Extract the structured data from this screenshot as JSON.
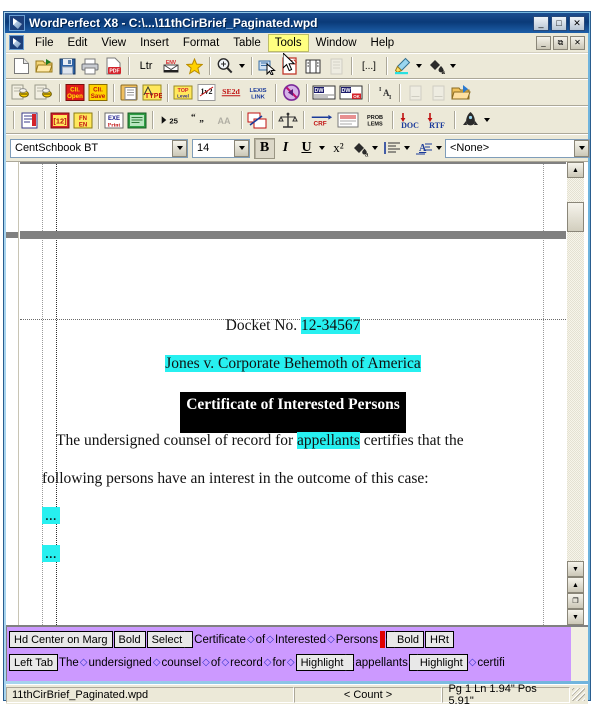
{
  "window": {
    "title": "WordPerfect X8 - C:\\...\\11thCirBrief_Paginated.wpd",
    "app_icon": "pen-nib-icon",
    "buttons": {
      "minimize": "_",
      "maximize": "□",
      "close": "✕"
    },
    "doc_buttons": {
      "minimize": "_",
      "restore": "⧉",
      "close": "✕"
    },
    "titlebar_color": "#0a3a78"
  },
  "menu": {
    "items": [
      {
        "label": "File",
        "accel": "F",
        "active": false
      },
      {
        "label": "Edit",
        "accel": "E",
        "active": false
      },
      {
        "label": "View",
        "accel": "V",
        "active": false
      },
      {
        "label": "Insert",
        "accel": "I",
        "active": false
      },
      {
        "label": "Format",
        "accel": "o",
        "active": false
      },
      {
        "label": "Table",
        "accel": "a",
        "active": false
      },
      {
        "label": "Tools",
        "accel": "T",
        "active": true
      },
      {
        "label": "Window",
        "accel": "W",
        "active": false
      },
      {
        "label": "Help",
        "accel": "H",
        "active": false
      }
    ],
    "highlight_color": "#ffff80"
  },
  "toolbar1": {
    "buttons": [
      {
        "name": "new-document-icon",
        "glyph": "🗋"
      },
      {
        "name": "open-document-icon",
        "glyph": "📂"
      },
      {
        "name": "save-document-icon",
        "glyph": "💾"
      },
      {
        "name": "print-icon",
        "glyph": "🖨"
      },
      {
        "name": "publish-pdf-icon",
        "glyph": "PDF"
      },
      {
        "name": "letter-template-icon",
        "glyph": "Ltr"
      },
      {
        "name": "envelope-icon",
        "glyph": "ENV"
      },
      {
        "name": "favorites-star-icon",
        "glyph": "★"
      },
      {
        "name": "zoom-icon",
        "glyph": "Q"
      },
      {
        "name": "select-tool-icon",
        "glyph": "⬚"
      },
      {
        "name": "new-page-icon",
        "glyph": "🗏"
      },
      {
        "name": "reveal-codes-icon",
        "glyph": "▥"
      },
      {
        "name": "columns-icon",
        "glyph": "▤"
      },
      {
        "name": "insert-field-icon",
        "glyph": "[...]"
      },
      {
        "name": "highlighter-icon",
        "glyph": "🖊"
      },
      {
        "name": "font-color-icon",
        "glyph": "🎨"
      }
    ]
  },
  "toolbar2": {
    "buttons": [
      {
        "name": "bee-insert-icon",
        "glyph": "🐝"
      },
      {
        "name": "bee-extract-icon",
        "glyph": "🐝"
      },
      {
        "name": "clipboard-open-icon",
        "glyph": "Cli.Open"
      },
      {
        "name": "clipboard-save-icon",
        "glyph": "Cli.Save"
      },
      {
        "name": "paste-list-icon",
        "glyph": "📋"
      },
      {
        "name": "type-icon",
        "glyph": "TYPE"
      },
      {
        "name": "top-level-icon",
        "glyph": "TOP"
      },
      {
        "name": "one-v-two-icon",
        "glyph": "1v2"
      },
      {
        "name": "se2d-icon",
        "glyph": "SE2d"
      },
      {
        "name": "lexis-link-icon",
        "glyph": "LEXIS LINK"
      },
      {
        "name": "no-link-icon",
        "glyph": "🚫"
      },
      {
        "name": "word-export-icon",
        "glyph": "DW"
      },
      {
        "name": "word-export-ok-icon",
        "glyph": "DW OK"
      },
      {
        "name": "text-format-icon",
        "glyph": "IA"
      },
      {
        "name": "page-left-icon",
        "glyph": "🗐"
      },
      {
        "name": "page-right-icon",
        "glyph": "🗐"
      },
      {
        "name": "open-folder-icon",
        "glyph": "📂"
      }
    ]
  },
  "toolbar3": {
    "buttons": [
      {
        "name": "table-of-authorities-icon",
        "glyph": "📕"
      },
      {
        "name": "numbering-icon",
        "glyph": "[12]"
      },
      {
        "name": "footnote-endnote-icon",
        "glyph": "FN↔EN"
      },
      {
        "name": "exe-print-icon",
        "glyph": "EXE Print"
      },
      {
        "name": "green-doc-icon",
        "glyph": "▤"
      },
      {
        "name": "jump-25-icon",
        "glyph": "▸25"
      },
      {
        "name": "quote-icon",
        "glyph": "“”"
      },
      {
        "name": "compare-icon",
        "glyph": "AA"
      },
      {
        "name": "swap-icon",
        "glyph": "⇄"
      },
      {
        "name": "scales-of-justice-icon",
        "glyph": "⚖"
      },
      {
        "name": "crf-icon",
        "glyph": "CRF"
      },
      {
        "name": "draft-icon",
        "glyph": "▤"
      },
      {
        "name": "problems-icon",
        "glyph": "PROB LEMS"
      },
      {
        "name": "save-as-doc-icon",
        "glyph": "DOC"
      },
      {
        "name": "save-as-rtf-icon",
        "glyph": "RTF"
      },
      {
        "name": "macro-icon",
        "glyph": "🚀"
      }
    ]
  },
  "property_bar": {
    "font_name": "CentSchbook BT",
    "font_size": "14",
    "bold_label": "B",
    "italic_label": "I",
    "underline_label": "U",
    "superscript_label": "x²",
    "highlight_icon": "highlighter-icon",
    "justification_icon": "align-left-icon",
    "text_style_icon": "text-style-icon",
    "style_value": "<None>",
    "bold_pressed": true
  },
  "document": {
    "lines": [
      {
        "id": "docket",
        "align": "center",
        "runs": [
          {
            "text": "Docket No. ",
            "style": "plain"
          },
          {
            "text": "12-34567",
            "style": "highlight"
          }
        ]
      },
      {
        "id": "caption",
        "align": "center",
        "runs": [
          {
            "text": "Jones v. Corporate Behemoth of America",
            "style": "highlight"
          }
        ]
      },
      {
        "id": "heading",
        "align": "center",
        "runs": [
          {
            "text": "Certificate of Interested Persons",
            "style": "selected-bold"
          }
        ]
      },
      {
        "id": "para1a",
        "align": "left",
        "runs": [
          {
            "text": "     The undersigned counsel of record for ",
            "style": "plain"
          },
          {
            "text": "appellants",
            "style": "highlight"
          },
          {
            "text": " certifies that the",
            "style": "plain"
          }
        ]
      },
      {
        "id": "para1b",
        "align": "left",
        "runs": [
          {
            "text": "following persons have an interest in the outcome of this case:",
            "style": "plain"
          }
        ]
      },
      {
        "id": "item1",
        "align": "left",
        "runs": [
          {
            "text": "...",
            "style": "highlight"
          }
        ]
      },
      {
        "id": "item2",
        "align": "left",
        "runs": [
          {
            "text": "...",
            "style": "highlight"
          }
        ]
      }
    ],
    "highlight_color": "#27f0f0",
    "selection_color": "#000000"
  },
  "reveal_codes": {
    "background_color": "#cc99ff",
    "line1": [
      {
        "kind": "code",
        "shape": "box",
        "label": "Hd Center on Marg"
      },
      {
        "kind": "code",
        "shape": "box",
        "label": "Bold"
      },
      {
        "kind": "code",
        "shape": "tab-right",
        "label": "Select"
      },
      {
        "kind": "text",
        "label": "Certificate"
      },
      {
        "kind": "diamond",
        "label": "◇"
      },
      {
        "kind": "text",
        "label": "of"
      },
      {
        "kind": "diamond",
        "label": "◇"
      },
      {
        "kind": "text",
        "label": "Interested"
      },
      {
        "kind": "diamond",
        "label": "◇"
      },
      {
        "kind": "text",
        "label": "Persons"
      },
      {
        "kind": "cursor",
        "label": ""
      },
      {
        "kind": "code",
        "shape": "tab-left",
        "label": "Bold"
      },
      {
        "kind": "code",
        "shape": "box",
        "label": "HRt"
      }
    ],
    "line2": [
      {
        "kind": "code",
        "shape": "box",
        "label": "Left Tab"
      },
      {
        "kind": "text",
        "label": "The"
      },
      {
        "kind": "diamond",
        "label": "◇"
      },
      {
        "kind": "text",
        "label": "undersigned"
      },
      {
        "kind": "diamond",
        "label": "◇"
      },
      {
        "kind": "text",
        "label": "counsel"
      },
      {
        "kind": "diamond",
        "label": "◇"
      },
      {
        "kind": "text",
        "label": "of"
      },
      {
        "kind": "diamond",
        "label": "◇"
      },
      {
        "kind": "text",
        "label": "record"
      },
      {
        "kind": "diamond",
        "label": "◇"
      },
      {
        "kind": "text",
        "label": "for"
      },
      {
        "kind": "diamond",
        "label": "◇"
      },
      {
        "kind": "code",
        "shape": "tab-right",
        "label": "Highlight"
      },
      {
        "kind": "text",
        "label": "appellants"
      },
      {
        "kind": "code",
        "shape": "tab-left",
        "label": "Highlight"
      },
      {
        "kind": "diamond",
        "label": "◇"
      },
      {
        "kind": "text",
        "label": "certifi"
      }
    ]
  },
  "status_bar": {
    "filename": "11thCirBrief_Paginated.wpd",
    "count": "< Count >",
    "position": "Pg 1 Ln 1.94\" Pos 5.91\""
  },
  "scrollbar": {
    "up_arrow": "▲",
    "down_arrow": "▼",
    "prev_page": "▲",
    "page_icon": "❐",
    "next_page": "▼"
  }
}
